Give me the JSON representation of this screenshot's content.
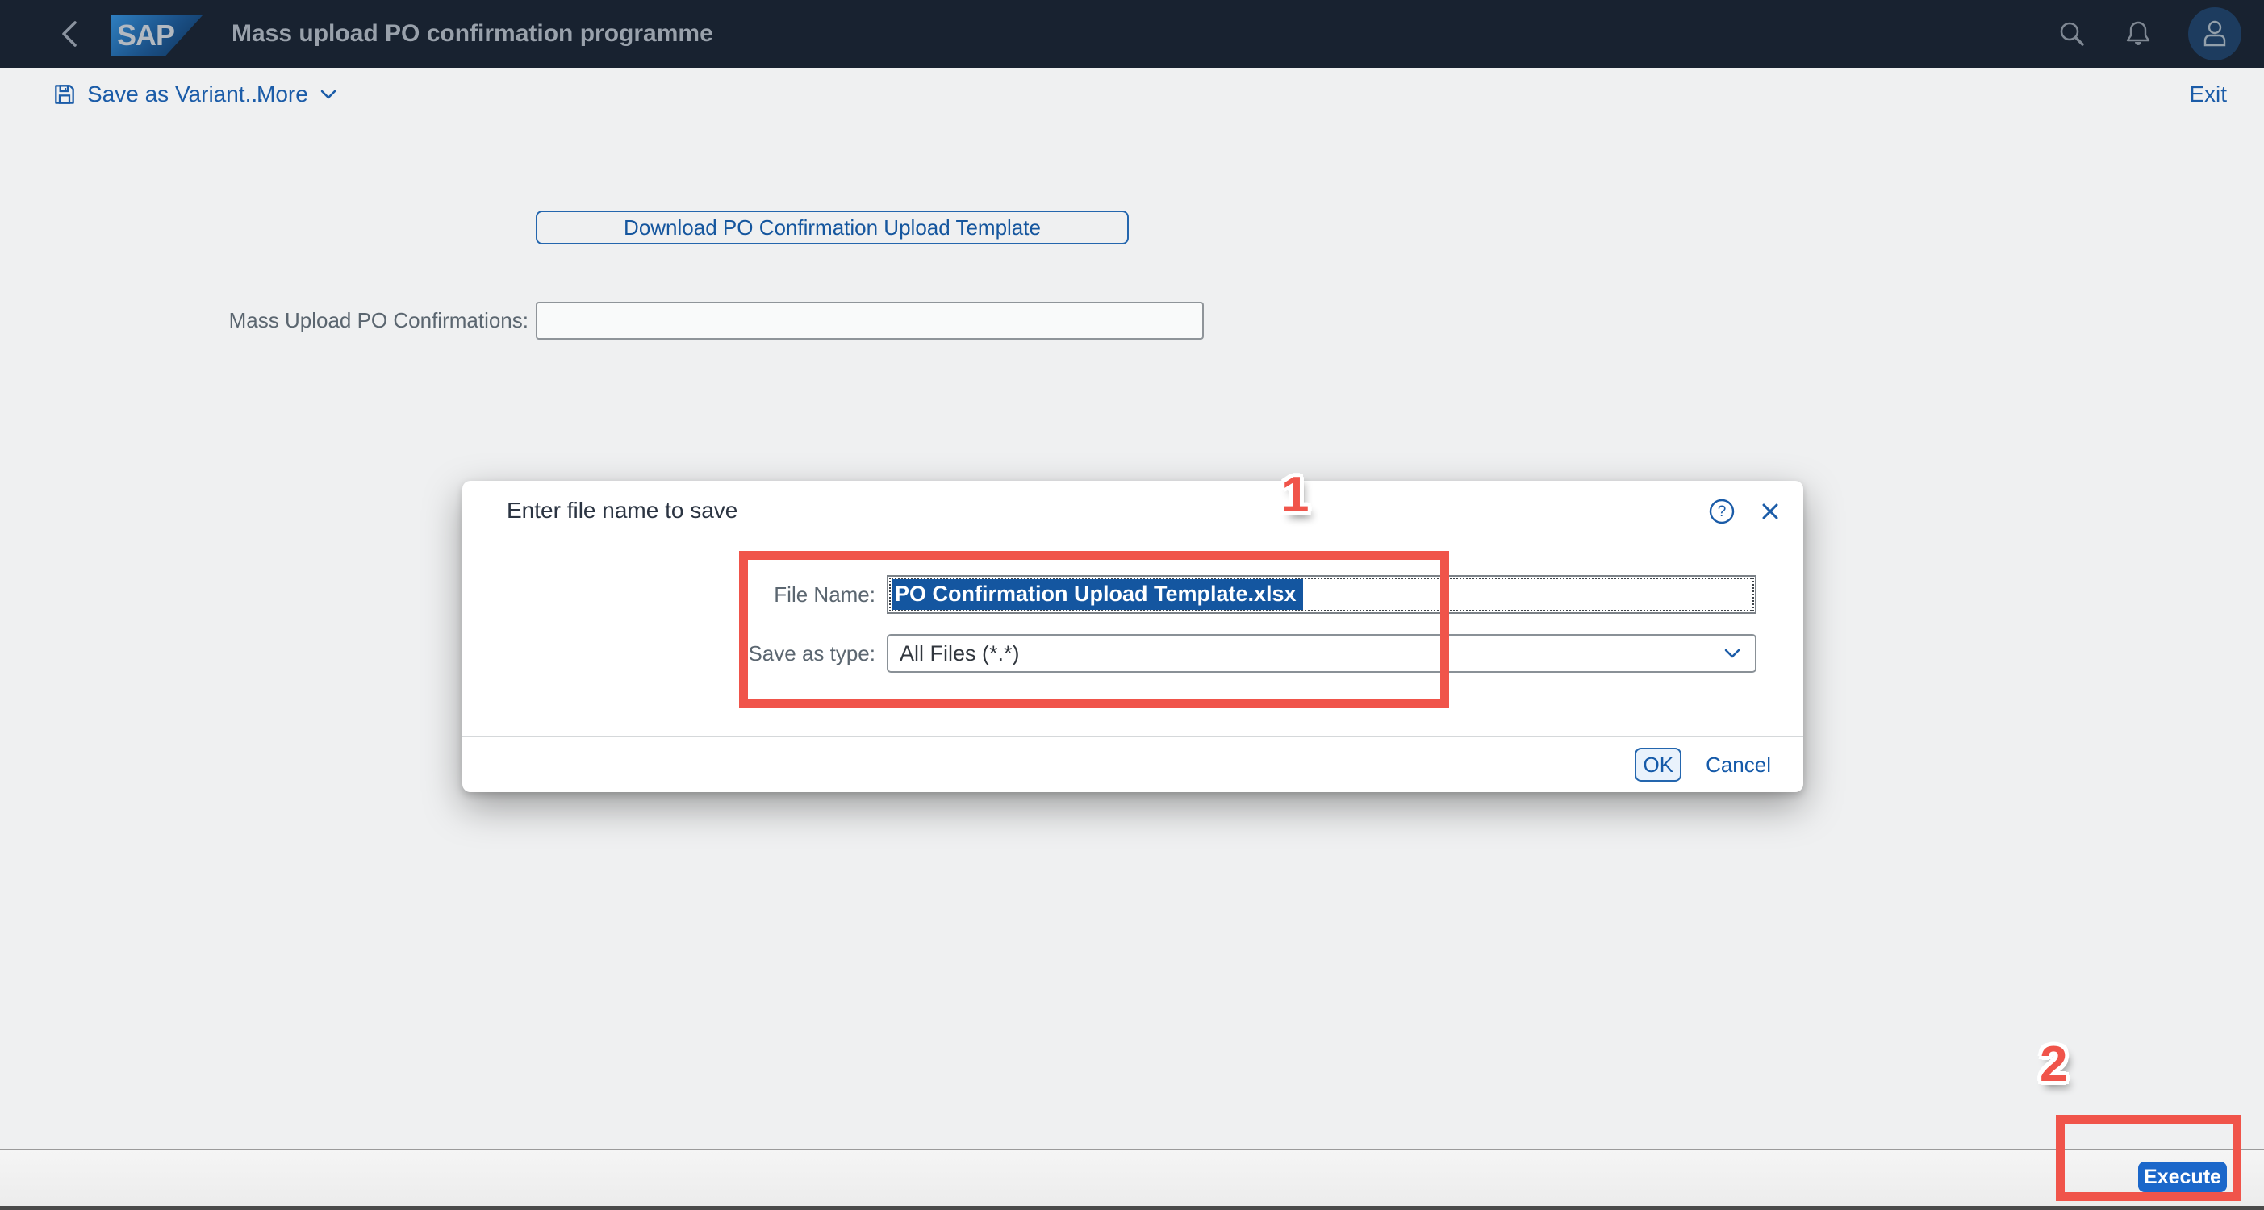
{
  "shell": {
    "logo": "SAP",
    "title": "Mass upload PO confirmation programme"
  },
  "toolbar": {
    "save_as_variant_label": "Save as Variant...",
    "more_label": "More",
    "exit_label": "Exit"
  },
  "main": {
    "download_button_label": "Download PO Confirmation Upload Template",
    "upload_label": "Mass Upload PO Confirmations:",
    "upload_value": ""
  },
  "dialog": {
    "title": "Enter file name to save",
    "file_name_label": "File Name:",
    "file_name_value": "PO Confirmation Upload Template.xlsx",
    "save_as_type_label": "Save as type:",
    "save_as_type_value": "All Files (*.*)",
    "ok_label": "OK",
    "cancel_label": "Cancel"
  },
  "footer": {
    "execute_label": "Execute"
  },
  "annotations": {
    "step1": "1",
    "step2": "2"
  },
  "colors": {
    "shell_bar": "#182230",
    "accent_link_blue": "#1b5ca8",
    "selection_blue": "#1456a0",
    "execute_blue": "#1b67ca",
    "annotation_red": "#f0544a",
    "page_background": "#eff0f1",
    "dialog_background": "#ffffff"
  }
}
